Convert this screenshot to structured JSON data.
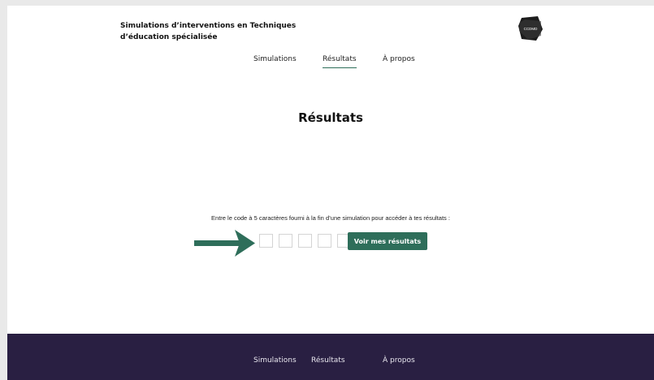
{
  "header": {
    "title_line1": "Simulations d’interventions en Techniques",
    "title_line2": "d’éducation spécialisée",
    "logo_text": "CCDMD",
    "nav": [
      "Simulations",
      "Résultats",
      "À propos"
    ],
    "active_nav": "Résultats"
  },
  "main": {
    "title": "Résultats",
    "instruction": "Entre le code à 5 caractères fourni à la fin d’une simulation pour accéder à tes résultats :",
    "code_length": 5,
    "submit_label": "Voir mes résultats"
  },
  "footer": {
    "nav": [
      "Simulations",
      "Résultats",
      "À propos"
    ]
  },
  "colors": {
    "accent": "#2e6e5a",
    "footer_bg": "#291f42",
    "background": "#ffffff"
  },
  "icons": {
    "logo": "ccdmd-logo-icon",
    "annotation": "arrow-right-icon"
  }
}
